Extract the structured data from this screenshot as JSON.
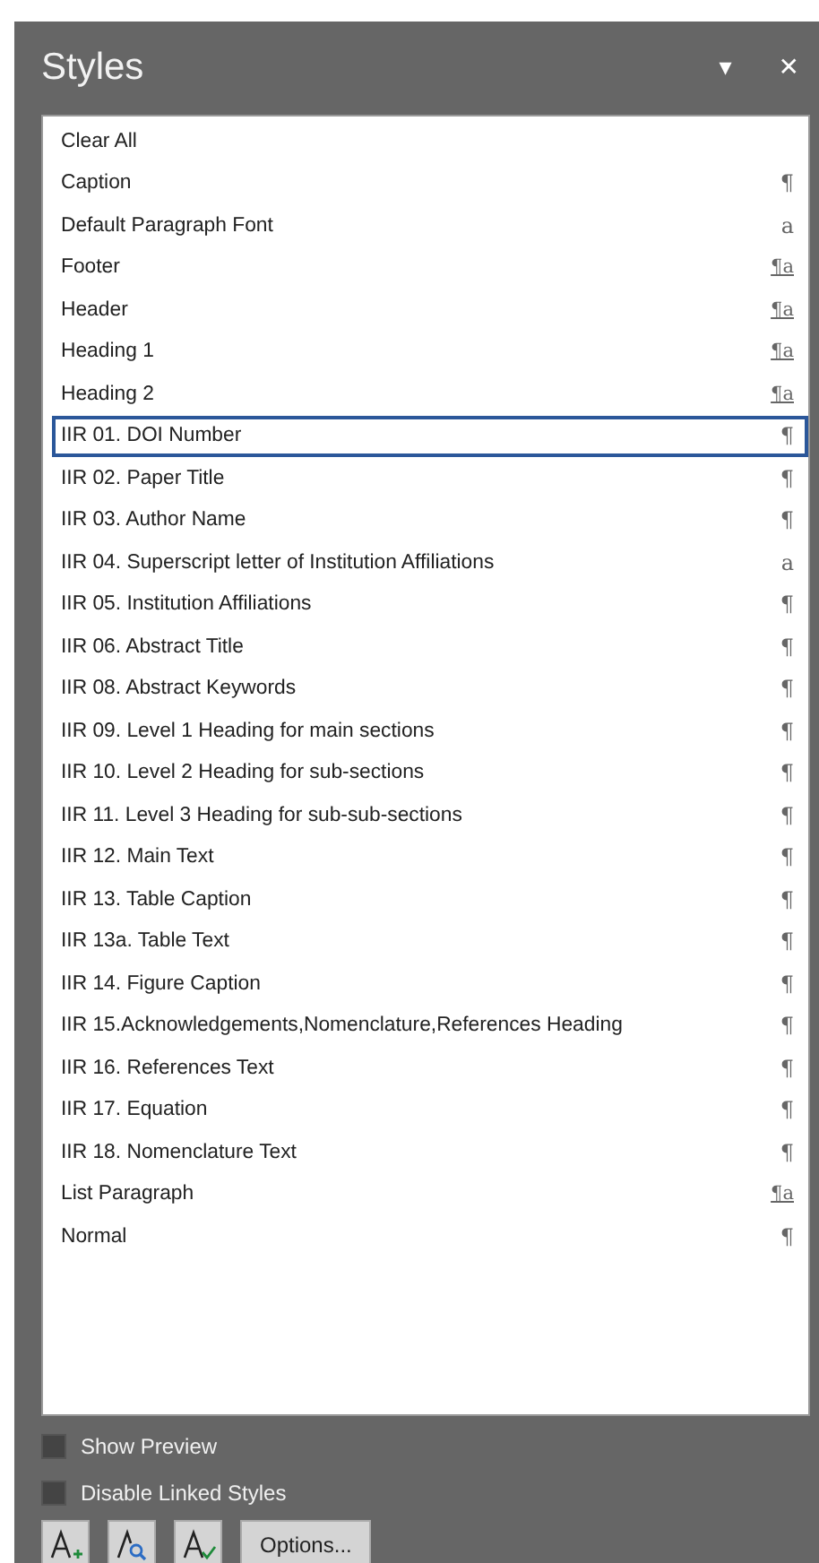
{
  "pane": {
    "title": "Styles",
    "menu_glyph": "▾",
    "close_glyph": "✕"
  },
  "styles": [
    {
      "name": "Clear All",
      "selected": false
    },
    {
      "name": "Caption",
      "mark": "¶",
      "kind": "paragraph",
      "selected": false
    },
    {
      "name": "Default Paragraph Font",
      "mark": "a",
      "kind": "character",
      "selected": false
    },
    {
      "name": "Footer",
      "mark": "¶a",
      "kind": "linked",
      "selected": false
    },
    {
      "name": "Header",
      "mark": "¶a",
      "kind": "linked",
      "selected": false
    },
    {
      "name": "Heading 1",
      "mark": "¶a",
      "kind": "linked",
      "selected": false
    },
    {
      "name": "Heading 2",
      "mark": "¶a",
      "kind": "linked",
      "selected": false
    },
    {
      "name": "IIR 01. DOI Number",
      "mark": "¶",
      "kind": "paragraph",
      "selected": true
    },
    {
      "name": "IIR 02. Paper Title",
      "mark": "¶",
      "kind": "paragraph",
      "selected": false
    },
    {
      "name": "IIR 03. Author Name",
      "mark": "¶",
      "kind": "paragraph",
      "selected": false
    },
    {
      "name": "IIR 04. Superscript letter of Institution Affiliations",
      "mark": "a",
      "kind": "character",
      "selected": false
    },
    {
      "name": "IIR 05. Institution Affiliations",
      "mark": "¶",
      "kind": "paragraph",
      "selected": false
    },
    {
      "name": "IIR 06. Abstract Title",
      "mark": "¶",
      "kind": "paragraph",
      "selected": false
    },
    {
      "name": "IIR 08. Abstract Keywords",
      "mark": "¶",
      "kind": "paragraph",
      "selected": false
    },
    {
      "name": "IIR 09. Level 1 Heading for main sections",
      "mark": "¶",
      "kind": "paragraph",
      "selected": false
    },
    {
      "name": "IIR 10. Level 2 Heading for sub-sections",
      "mark": "¶",
      "kind": "paragraph",
      "selected": false
    },
    {
      "name": "IIR 11. Level 3 Heading for sub-sub-sections",
      "mark": "¶",
      "kind": "paragraph",
      "selected": false
    },
    {
      "name": "IIR 12. Main Text",
      "mark": "¶",
      "kind": "paragraph",
      "selected": false
    },
    {
      "name": "IIR 13. Table Caption",
      "mark": "¶",
      "kind": "paragraph",
      "selected": false
    },
    {
      "name": "IIR 13a. Table Text",
      "mark": "¶",
      "kind": "paragraph",
      "selected": false
    },
    {
      "name": "IIR 14. Figure Caption",
      "mark": "¶",
      "kind": "paragraph",
      "selected": false
    },
    {
      "name": "IIR 15.Acknowledgements,Nomenclature,References Heading",
      "mark": "¶",
      "kind": "paragraph",
      "selected": false
    },
    {
      "name": "IIR 16. References Text",
      "mark": "¶",
      "kind": "paragraph",
      "selected": false
    },
    {
      "name": "IIR 17. Equation",
      "mark": "¶",
      "kind": "paragraph",
      "selected": false
    },
    {
      "name": "IIR 18. Nomenclature Text",
      "mark": "¶",
      "kind": "paragraph",
      "selected": false
    },
    {
      "name": "List Paragraph",
      "mark": "¶a",
      "kind": "linked",
      "selected": false
    },
    {
      "name": "Normal",
      "mark": "¶",
      "kind": "paragraph",
      "selected": false
    }
  ],
  "options": [
    {
      "label": "Show Preview",
      "checked": false
    },
    {
      "label": "Disable Linked Styles",
      "checked": false
    }
  ],
  "buttons": {
    "options_label": "Options..."
  }
}
